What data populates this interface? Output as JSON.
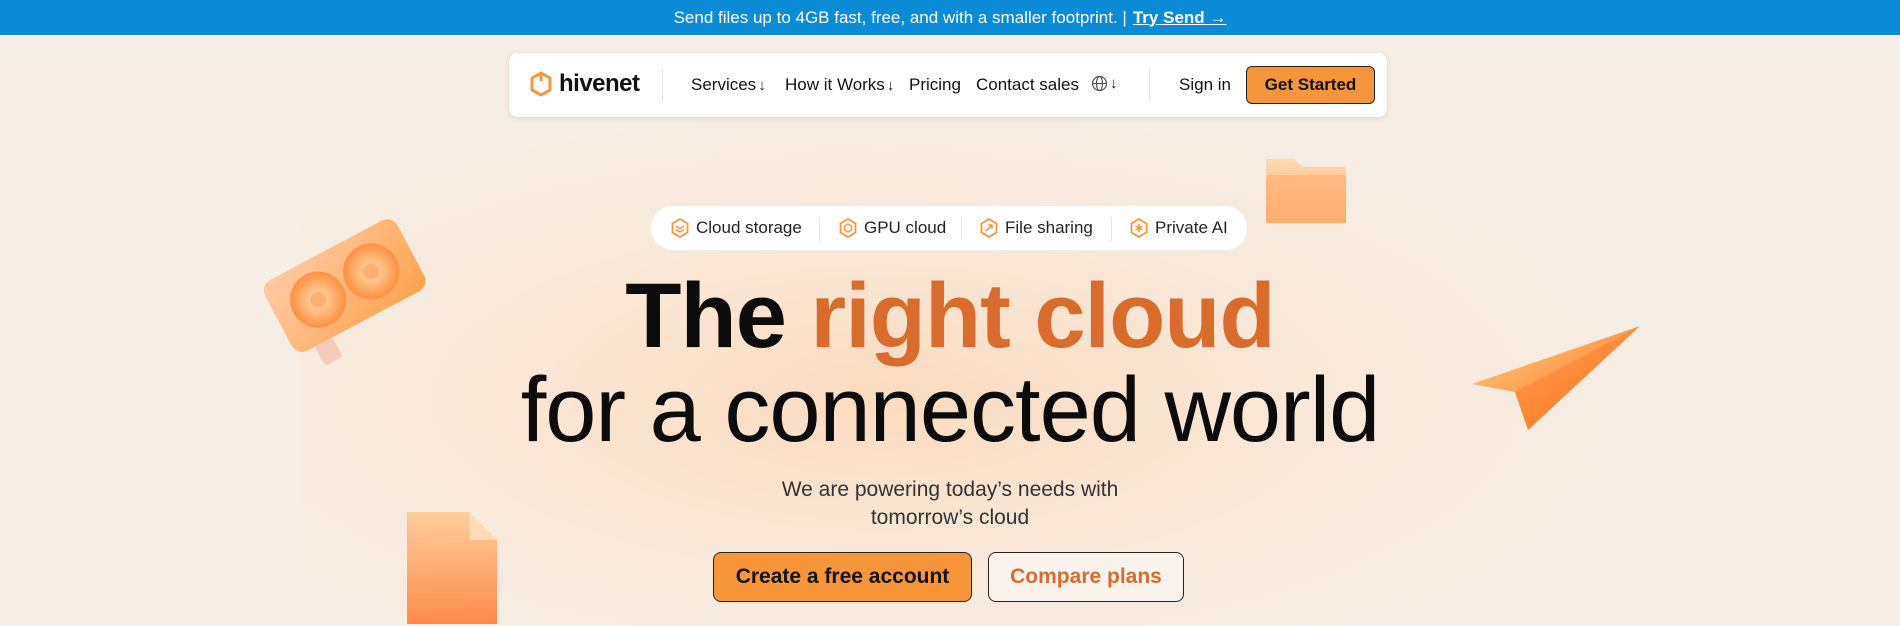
{
  "banner": {
    "text": "Send files up to 4GB fast, free, and with a smaller footprint. |",
    "link": "Try Send →"
  },
  "nav": {
    "logo": "hivenet",
    "items": [
      {
        "label": "Services",
        "arrow": "↓"
      },
      {
        "label": "How it Works",
        "arrow": "↓"
      },
      {
        "label": "Pricing"
      },
      {
        "label": "Contact sales"
      }
    ],
    "lang_arrow": "↓",
    "signin": "Sign in",
    "get_started": "Get Started"
  },
  "pills": [
    {
      "label": "Cloud storage",
      "icon": "cloud-storage-icon"
    },
    {
      "label": "GPU cloud",
      "icon": "gpu-cloud-icon"
    },
    {
      "label": "File sharing",
      "icon": "file-sharing-icon"
    },
    {
      "label": "Private AI",
      "icon": "private-ai-icon"
    }
  ],
  "hero": {
    "line1_a": "The",
    "line1_b": "right cloud",
    "line2": "for a connected world",
    "sub1": "We are powering today’s needs with",
    "sub2": "tomorrow’s cloud"
  },
  "cta": {
    "primary": "Create a free account",
    "secondary": "Compare plans"
  },
  "colors": {
    "banner": "#0b8bd6",
    "accent": "#f7953a",
    "accent_text": "#d96c2c",
    "background": "#f6ede4"
  }
}
